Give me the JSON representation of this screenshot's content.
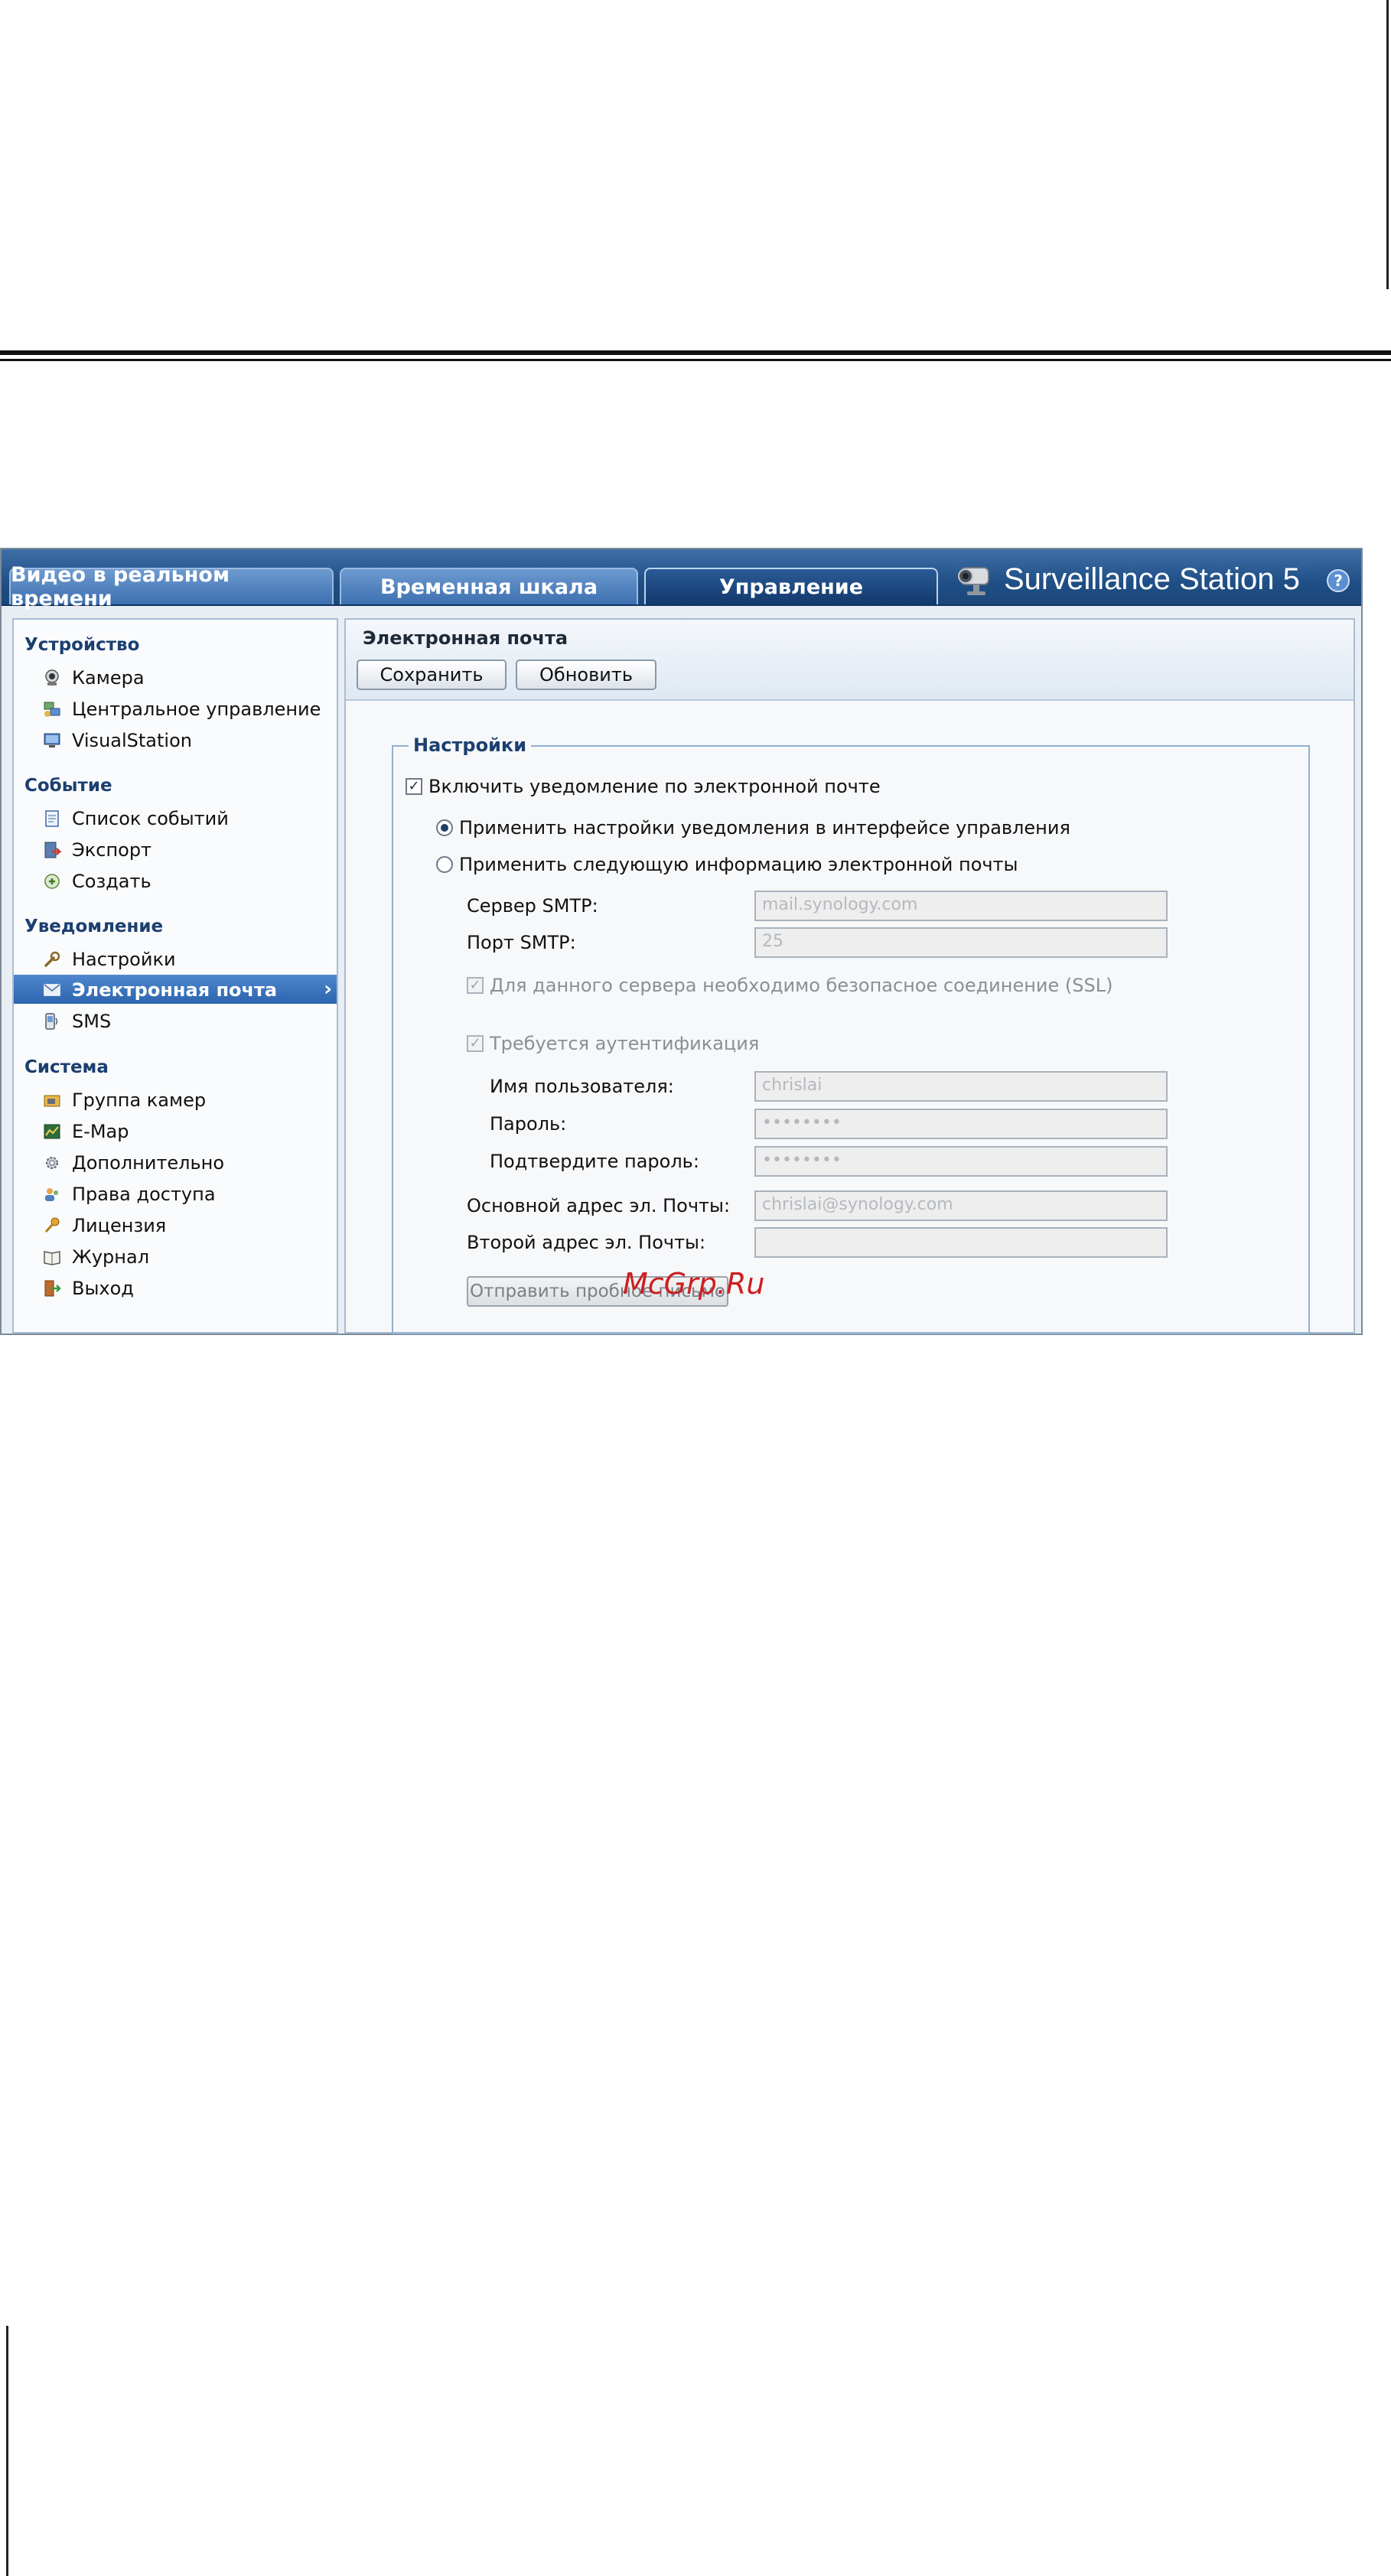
{
  "tabs": {
    "live": "Видео в реальном времени",
    "timeline": "Временная шкала",
    "manage": "Управление"
  },
  "brand": "Surveillance Station 5",
  "help_label": "?",
  "sidebar": {
    "sections": {
      "device": "Устройство",
      "event": "Событие",
      "notification": "Уведомление",
      "system": "Система"
    },
    "items": {
      "camera": "Камера",
      "cms": "Центральное управление",
      "visualstation": "VisualStation",
      "event_list": "Список событий",
      "export": "Экспорт",
      "create": "Создать",
      "settings": "Настройки",
      "email": "Электронная почта",
      "sms": "SMS",
      "camera_group": "Группа камер",
      "emap": "E-Map",
      "advanced": "Дополнительно",
      "privileges": "Права доступа",
      "license": "Лицензия",
      "log": "Журнал",
      "logout": "Выход"
    },
    "active": "email"
  },
  "content": {
    "title": "Электронная почта",
    "save_label": "Сохранить",
    "refresh_label": "Обновить",
    "fieldset_title": "Настройки",
    "enable_email": {
      "label": "Включить уведомление по электронной почте",
      "checked": true
    },
    "radio_use_ui": {
      "label": "Применить настройки уведомления в интерфейсе управления",
      "selected": true
    },
    "radio_use_custom": {
      "label": "Применить следующую информацию электронной почты",
      "selected": false
    },
    "smtp_server": {
      "label": "Сервер SMTP:",
      "value": "mail.synology.com"
    },
    "smtp_port": {
      "label": "Порт SMTP:",
      "value": "25"
    },
    "ssl": {
      "label": "Для данного сервера необходимо безопасное соединение (SSL)",
      "checked": true
    },
    "auth": {
      "label": "Требуется аутентификация",
      "checked": true
    },
    "username": {
      "label": "Имя пользователя:",
      "value": "chrislai"
    },
    "password": {
      "label": "Пароль:",
      "value": "••••••••"
    },
    "password_confirm": {
      "label": "Подтвердите пароль:",
      "value": "••••••••"
    },
    "primary_email": {
      "label": "Основной адрес эл. Почты:",
      "value": "chrislai@synology.com"
    },
    "secondary_email": {
      "label": "Второй адрес эл. Почты:",
      "value": ""
    },
    "test_button": "Отправить пробное письмо"
  },
  "watermark": "McGrp.Ru",
  "colors": {
    "topbar": "#1f4f86",
    "active_item": "#2c65ad",
    "section_heading": "#1b3f70",
    "watermark": "#cc1f1f"
  }
}
